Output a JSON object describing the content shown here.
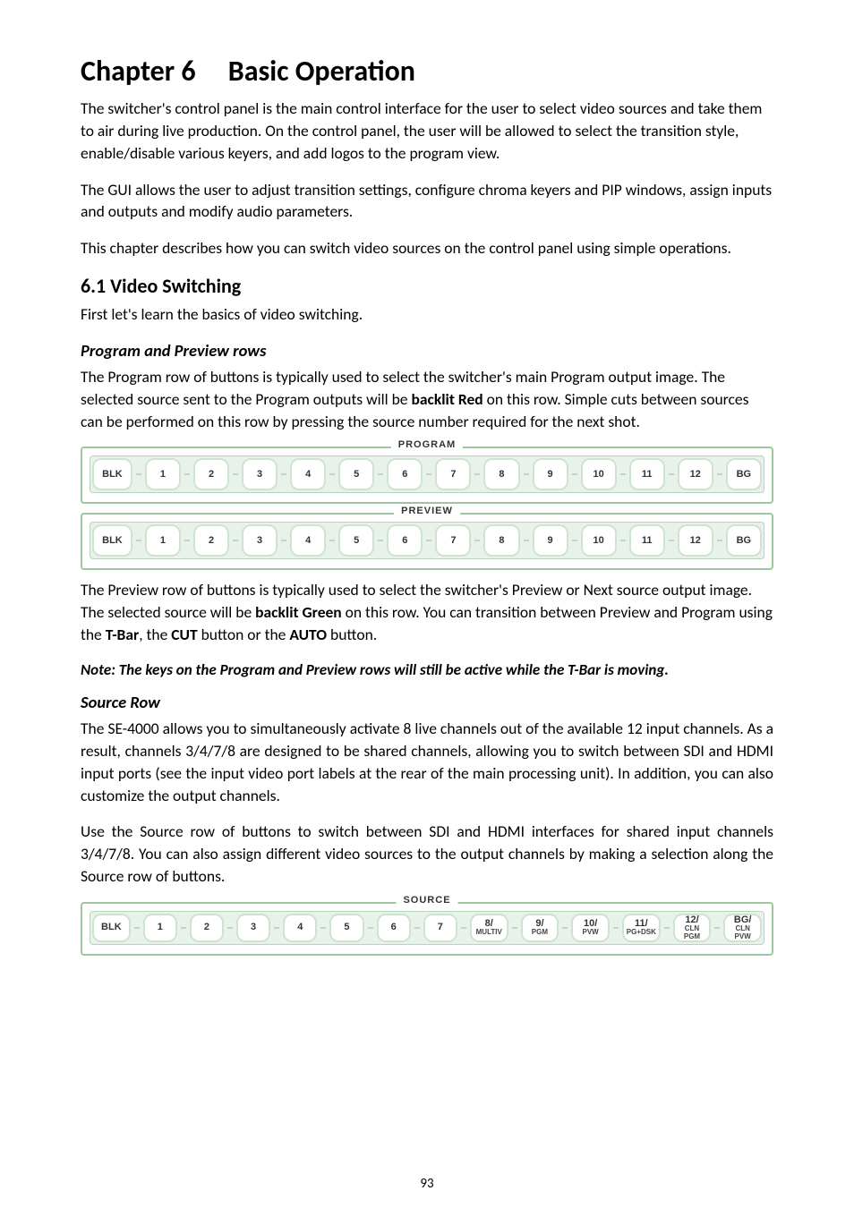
{
  "chapter_title": "Chapter 6     Basic Operation",
  "intro_p1": "The switcher's control panel is the main control interface for the user to select video sources and take them to air during live production. On the control panel, the user will be allowed to select the transition style, enable/disable various keyers, and add logos to the program view.",
  "intro_p2": "The GUI allows the user to adjust transition settings, configure chroma keyers and PIP windows, assign inputs and outputs and modify audio parameters.",
  "intro_p3": "This chapter describes how you can switch video sources on the control panel using simple operations.",
  "section1_title": "6.1 Video Switching",
  "section1_intro": "First let's learn the basics of video switching.",
  "subsection_ppr_title": "Program and Preview rows",
  "ppr_p1_a": "The Program row of buttons is typically used to select the switcher's main Program output image. The selected source sent to the Program outputs will be ",
  "ppr_p1_bold": "backlit Red",
  "ppr_p1_b": " on this row. Simple cuts between sources can be performed on this row by pressing the source number required for the next shot.",
  "ppr_p2_a": "The Preview row of buttons is typically used to select the switcher's Preview or Next source output image. The selected source will be ",
  "ppr_p2_bold1": "backlit Green",
  "ppr_p2_b": " on this row. You can transition between Preview and Program using the ",
  "ppr_p2_bold2": "T-Bar",
  "ppr_p2_c": ", the ",
  "ppr_p2_bold3": "CUT",
  "ppr_p2_d": " button or the ",
  "ppr_p2_bold4": "AUTO",
  "ppr_p2_e": " button.",
  "note_text": "Note: The keys on the Program and Preview rows will still be active while the T-Bar is moving.",
  "subsection_source_title": "Source Row",
  "source_p1": "The SE-4000 allows you to simultaneously activate 8 live channels out of the available 12 input channels. As a result, channels 3/4/7/8 are designed to be shared channels, allowing you to switch between SDI and HDMI input ports (see the input video port labels at the rear of the main processing unit). In addition, you can also customize the output channels.",
  "source_p2": "Use the Source row of buttons to switch between SDI and HDMI interfaces for shared input channels 3/4/7/8. You can also assign different video sources to the output channels by making a selection along the Source row of buttons.",
  "panels": {
    "program": {
      "legend": "PROGRAM",
      "keys": [
        "BLK",
        "1",
        "2",
        "3",
        "4",
        "5",
        "6",
        "7",
        "8",
        "9",
        "10",
        "11",
        "12",
        "BG"
      ]
    },
    "preview": {
      "legend": "PREVIEW",
      "keys": [
        "BLK",
        "1",
        "2",
        "3",
        "4",
        "5",
        "6",
        "7",
        "8",
        "9",
        "10",
        "11",
        "12",
        "BG"
      ]
    },
    "source": {
      "legend": "SOURCE",
      "keys": [
        {
          "main": "BLK"
        },
        {
          "main": "1"
        },
        {
          "main": "2"
        },
        {
          "main": "3"
        },
        {
          "main": "4"
        },
        {
          "main": "5"
        },
        {
          "main": "6"
        },
        {
          "main": "7"
        },
        {
          "main": "8/",
          "sub": "MULTIV"
        },
        {
          "main": "9/",
          "sub": "PGM"
        },
        {
          "main": "10/",
          "sub": "PVW"
        },
        {
          "main": "11/",
          "sub": "PG+DSK"
        },
        {
          "main": "12/",
          "sub": "CLN PGM"
        },
        {
          "main": "BG/",
          "sub": "CLN PVW"
        }
      ]
    }
  },
  "page_number": "93"
}
